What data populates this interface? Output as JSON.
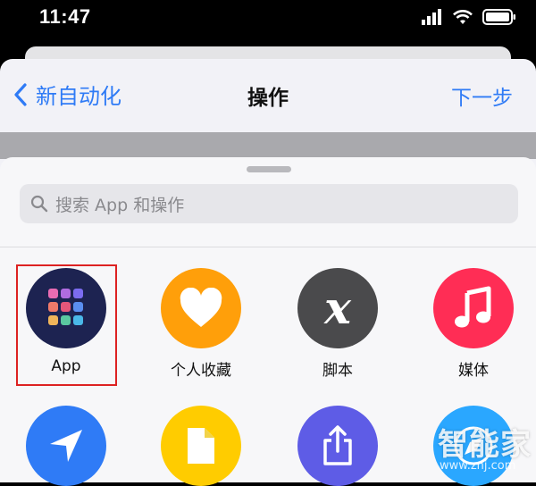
{
  "status": {
    "time": "11:47"
  },
  "nav": {
    "back_label": "新自动化",
    "title": "操作",
    "next_label": "下一步"
  },
  "search": {
    "placeholder": "搜索 App 和操作"
  },
  "actions": [
    {
      "label": "App",
      "icon": "app-grid-icon",
      "color": "#1d2351"
    },
    {
      "label": "个人收藏",
      "icon": "heart-icon",
      "color": "#ff9f0a"
    },
    {
      "label": "脚本",
      "icon": "script-x-icon",
      "color": "#4a4a4c"
    },
    {
      "label": "媒体",
      "icon": "music-note-icon",
      "color": "#ff2d55"
    }
  ],
  "actions_row2": [
    {
      "label": "",
      "icon": "location-arrow-icon",
      "color": "#2f7bf6"
    },
    {
      "label": "",
      "icon": "document-icon",
      "color": "#ffcc00"
    },
    {
      "label": "",
      "icon": "share-icon",
      "color": "#5e5ce6"
    },
    {
      "label": "",
      "icon": "compass-icon",
      "color": "#2aa7ff"
    }
  ],
  "watermark": {
    "text": "智能家",
    "url": "www.znj.com"
  }
}
